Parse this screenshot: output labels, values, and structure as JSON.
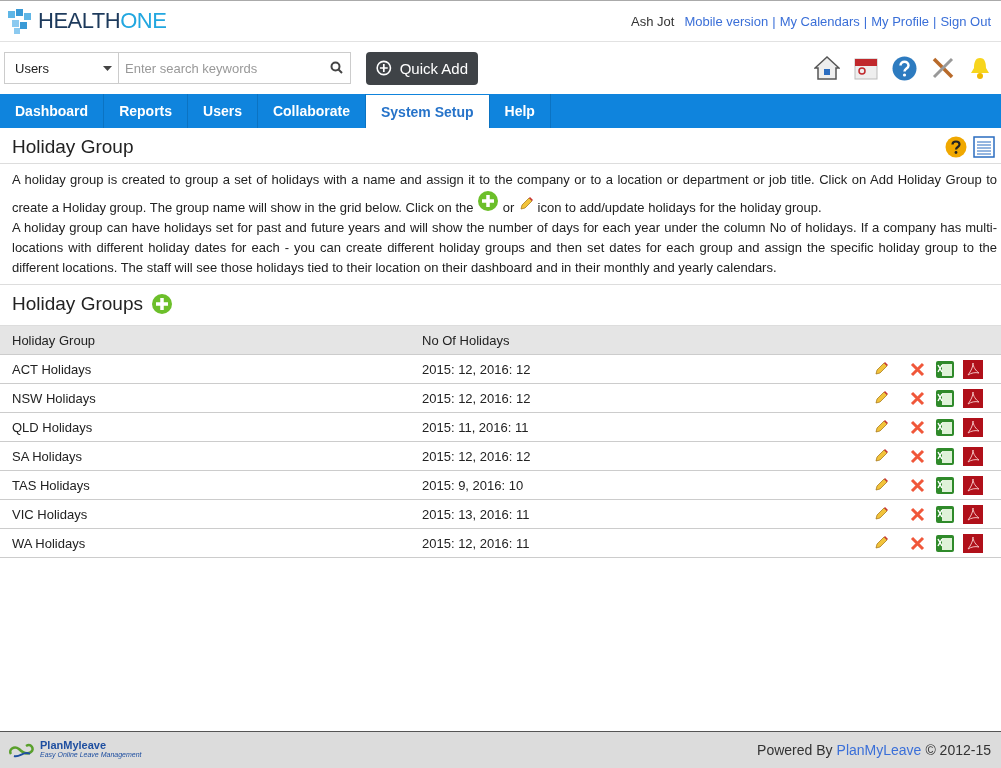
{
  "logo": {
    "part1": "HEALTH",
    "part2": "ONE"
  },
  "user": "Ash Jot",
  "top_links": [
    "Mobile version",
    "My Calendars",
    "My Profile",
    "Sign Out"
  ],
  "link_separator": "|",
  "search": {
    "scope": "Users",
    "placeholder": "Enter search keywords"
  },
  "quick_add": "Quick Add",
  "nav": [
    {
      "label": "Dashboard",
      "selected": false
    },
    {
      "label": "Reports",
      "selected": false
    },
    {
      "label": "Users",
      "selected": false
    },
    {
      "label": "Collaborate",
      "selected": false
    },
    {
      "label": "System Setup",
      "selected": true
    },
    {
      "label": "Help",
      "selected": false
    }
  ],
  "page_title": "Holiday Group",
  "description": {
    "before_add_icon": "A holiday group is created to group a set of holidays with a name and assign it to the company or to a location or department or job title. Click on Add Holiday Group to create a Holiday group. The group name will show in the grid below. Click on the",
    "between_icons": "or",
    "after_edit_icon": "icon to add/update holidays for the holiday group.",
    "paragraph_2": "A holiday group can have holidays set for past and future years and will show the number of days for each year under the column No of holidays. If a company has multi-locations with different holiday dates for each - you can create different holiday groups and then set dates for each group and assign the specific holiday group to the different locations. The staff will see those holidays tied to their location on their dashboard and in their monthly and yearly calendars."
  },
  "section_title": "Holiday Groups",
  "table": {
    "columns": [
      "Holiday Group",
      "No Of Holidays"
    ],
    "rows": [
      [
        "ACT Holidays",
        "2015: 12, 2016: 12"
      ],
      [
        "NSW Holidays",
        "2015: 12, 2016: 12"
      ],
      [
        "QLD Holidays",
        "2015: 11, 2016: 11"
      ],
      [
        "SA Holidays",
        "2015: 12, 2016: 12"
      ],
      [
        "TAS Holidays",
        "2015: 9, 2016: 10"
      ],
      [
        "VIC Holidays",
        "2015: 13, 2016: 11"
      ],
      [
        "WA Holidays",
        "2015: 12, 2016: 11"
      ]
    ]
  },
  "footer": {
    "logo_name": "PlanMyleave",
    "logo_tagline": "Easy Online Leave Management",
    "powered_by": "Powered By",
    "brand_link": "PlanMyLeave",
    "copyright": "© 2012-15"
  }
}
